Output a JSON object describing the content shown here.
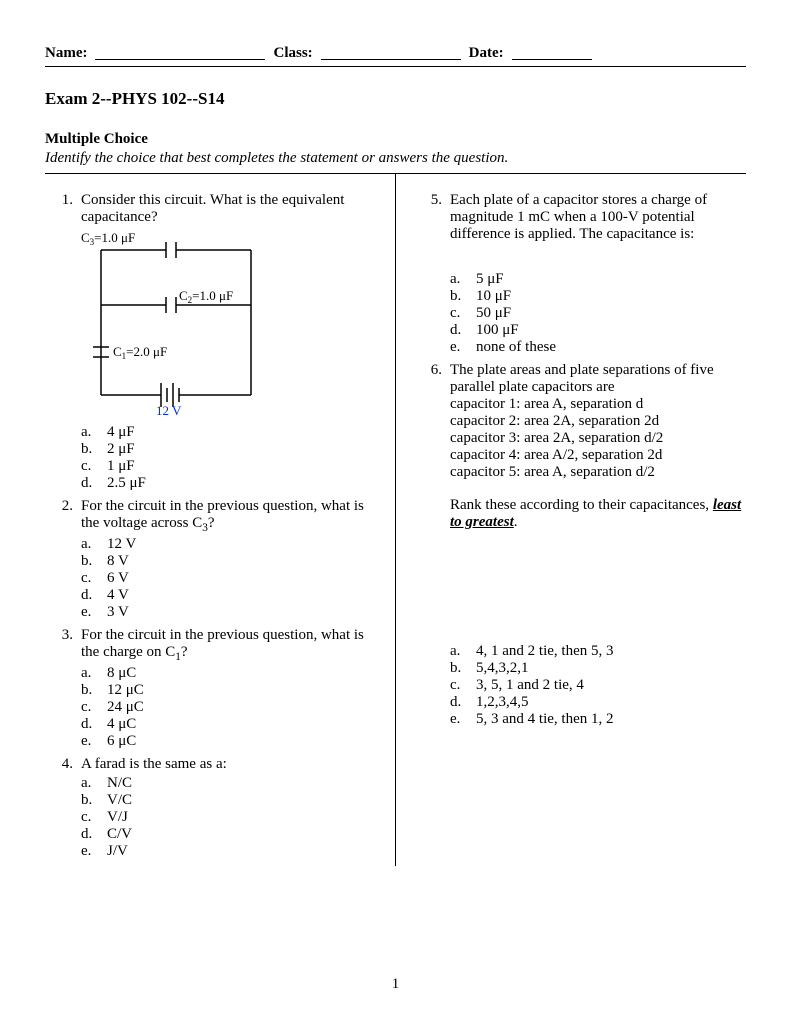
{
  "header": {
    "name_label": "Name:",
    "class_label": "Class:",
    "date_label": "Date:"
  },
  "title": "Exam 2--PHYS 102--S14",
  "section": {
    "heading": "Multiple Choice",
    "instructions": "Identify the choice that best completes the statement or answers the question."
  },
  "circuit": {
    "c3": "C",
    "c3sub": "3",
    "c3val": "=1.0 μF",
    "c2": "C",
    "c2sub": "2",
    "c2val": "=1.0 μF",
    "c1": "C",
    "c1sub": "1",
    "c1val": "=2.0 μF",
    "v": "12 V"
  },
  "q1": {
    "num": "1.",
    "text": "Consider this circuit.  What is the equivalent capacitance?",
    "a": "4 μF",
    "b": "2 μF",
    "c": "1 μF",
    "d": "2.5 μF"
  },
  "q2": {
    "num": "2.",
    "text_pre": "For the circuit in the previous question, what is the voltage across C",
    "text_sub": "3",
    "text_post": "?",
    "a": "12 V",
    "b": "8 V",
    "c": "6 V",
    "d": "4 V",
    "e": "3 V"
  },
  "q3": {
    "num": "3.",
    "text_pre": "For the circuit in the previous question, what is the charge on C",
    "text_sub": "1",
    "text_post": "?",
    "a": "8 μC",
    "b": "12 μC",
    "c": "24 μC",
    "d": "4 μC",
    "e": "6 μC"
  },
  "q4": {
    "num": "4.",
    "text": "A farad is the same as a:",
    "a": "N/C",
    "b": "V/C",
    "c": "V/J",
    "d": "C/V",
    "e": "J/V"
  },
  "q5": {
    "num": "5.",
    "text": "Each plate of a capacitor stores a charge of magnitude 1 mC when a 100-V potential difference is applied. The capacitance is:",
    "a": "5 μF",
    "b": "10 μF",
    "c": "50 μF",
    "d": "100 μF",
    "e": "none of these"
  },
  "q6": {
    "num": "6.",
    "text": "The plate areas and plate separations of five parallel plate capacitors are",
    "cap1": "capacitor 1: area A, separation d",
    "cap2": "capacitor 2: area 2A, separation 2d",
    "cap3": "capacitor 3: area 2A, separation d/2",
    "cap4": "capacitor 4: area A/2, separation 2d",
    "cap5": "capacitor 5: area A, separation d/2",
    "rank_pre": "Rank these according to their capacitances, ",
    "rank_em": "least to greatest",
    "rank_post": ".",
    "a": "4, 1 and 2 tie, then 5, 3",
    "b": "5,4,3,2,1",
    "c": "3, 5, 1 and 2 tie, 4",
    "d": "1,2,3,4,5",
    "e": "5, 3 and 4 tie, then 1, 2"
  },
  "letters": {
    "a": "a.",
    "b": "b.",
    "c": "c.",
    "d": "d.",
    "e": "e."
  },
  "page": "1"
}
